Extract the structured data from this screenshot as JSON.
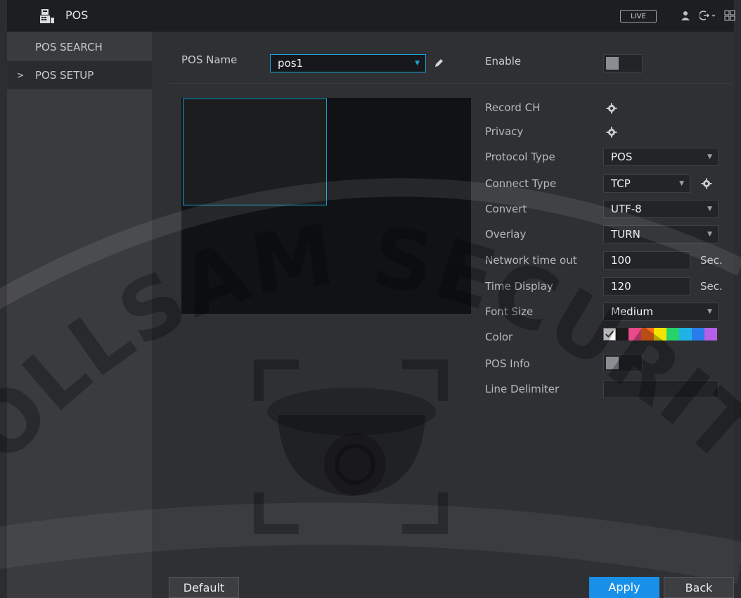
{
  "titlebar": {
    "title": "POS",
    "live_label": "LIVE",
    "icons": [
      "pos-icon",
      "user-icon",
      "logout-icon",
      "grid-icon"
    ]
  },
  "sidebar": {
    "items": [
      {
        "label": "POS SEARCH",
        "active": false
      },
      {
        "label": "POS SETUP",
        "active": true,
        "indicator": ">"
      }
    ]
  },
  "form": {
    "pos_name_label": "POS Name",
    "pos_name_value": "pos1",
    "enable_label": "Enable",
    "record_ch_label": "Record CH",
    "privacy_label": "Privacy",
    "protocol_type_label": "Protocol Type",
    "protocol_type_value": "POS",
    "connect_type_label": "Connect Type",
    "connect_type_value": "TCP",
    "convert_label": "Convert",
    "convert_value": "UTF-8",
    "overlay_label": "Overlay",
    "overlay_value": "TURN",
    "network_timeout_label": "Network time out",
    "network_timeout_value": "100",
    "network_timeout_unit": "Sec.",
    "time_display_label": "Time Display",
    "time_display_value": "120",
    "time_display_unit": "Sec.",
    "font_size_label": "Font Size",
    "font_size_value": "Medium",
    "color_label": "Color",
    "color_swatches": [
      "#ffffff",
      "#1b1b1b",
      "#e84a8a",
      "#ff6a1a",
      "#f2e400",
      "#27d36b",
      "#1fb2e6",
      "#2a7ce8",
      "#b45fe6"
    ],
    "pos_info_label": "POS Info",
    "line_delimiter_label": "Line Delimiter",
    "line_delimiter_value": ""
  },
  "watermark": {
    "text": "ROLLSAM SECURITY"
  },
  "buttons": {
    "default": "Default",
    "apply": "Apply",
    "back": "Back"
  },
  "colors": {
    "accent": "#1aa1d8",
    "apply": "#1890e8"
  }
}
